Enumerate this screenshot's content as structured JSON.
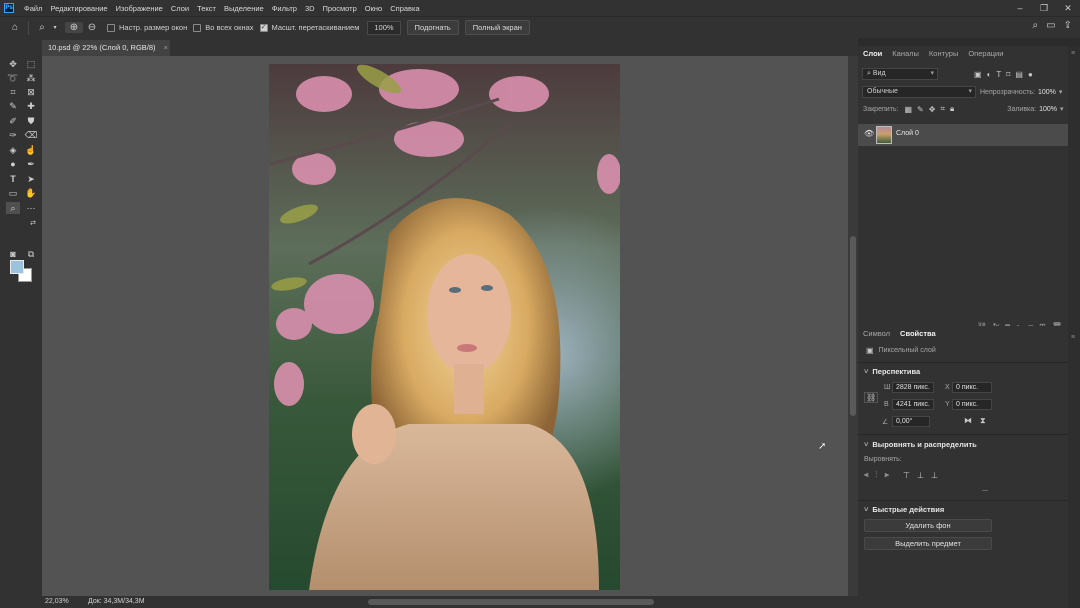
{
  "menu": {
    "logo": "Ps",
    "items": [
      "Файл",
      "Редактирование",
      "Изображение",
      "Слои",
      "Текст",
      "Выделение",
      "Фильтр",
      "3D",
      "Просмотр",
      "Окно",
      "Справка"
    ]
  },
  "options": {
    "resize_windows": "Настр. размер окон",
    "all_windows": "Во всех окнах",
    "scrubby_zoom": "Масшт. перетаскиванием",
    "zoom_value": "100%",
    "fit_btn": "Подогнать",
    "fullscreen_btn": "Полный экран"
  },
  "document": {
    "tab_title": "10.psd @ 22% (Слой 0, RGB/8)",
    "close": "×"
  },
  "status": {
    "zoom": "22,03%",
    "doc": "Док: 34,3M/34,3M"
  },
  "layers_panel": {
    "tabs": [
      "Слои",
      "Каналы",
      "Контуры",
      "Операции"
    ],
    "filter_label": "Вид",
    "blend_mode": "Обычные",
    "opacity_label": "Непрозрачность:",
    "opacity_value": "100%",
    "lock_label": "Закрепить:",
    "fill_label": "Заливка:",
    "fill_value": "100%",
    "layer_name": "Слой 0"
  },
  "properties_panel": {
    "tabs": [
      "Символ",
      "Свойства"
    ],
    "kind": "Пиксельный слой",
    "transform_title": "Перспектива",
    "w_label": "Ш",
    "w_value": "2828 пикс.",
    "h_label": "В",
    "h_value": "4241 пикс.",
    "x_label": "X",
    "x_value": "0 пикс.",
    "y_label": "Y",
    "y_value": "0 пикс.",
    "angle_value": "0,00°",
    "align_title": "Выровнять и распределить",
    "align_label": "Выровнять:",
    "more": "...",
    "quick_title": "Быстрые действия",
    "remove_bg_btn": "Удалить фон",
    "select_subject_btn": "Выделить предмет"
  },
  "colors": {
    "foreground": "#9bc3de",
    "background": "#ffffff"
  }
}
